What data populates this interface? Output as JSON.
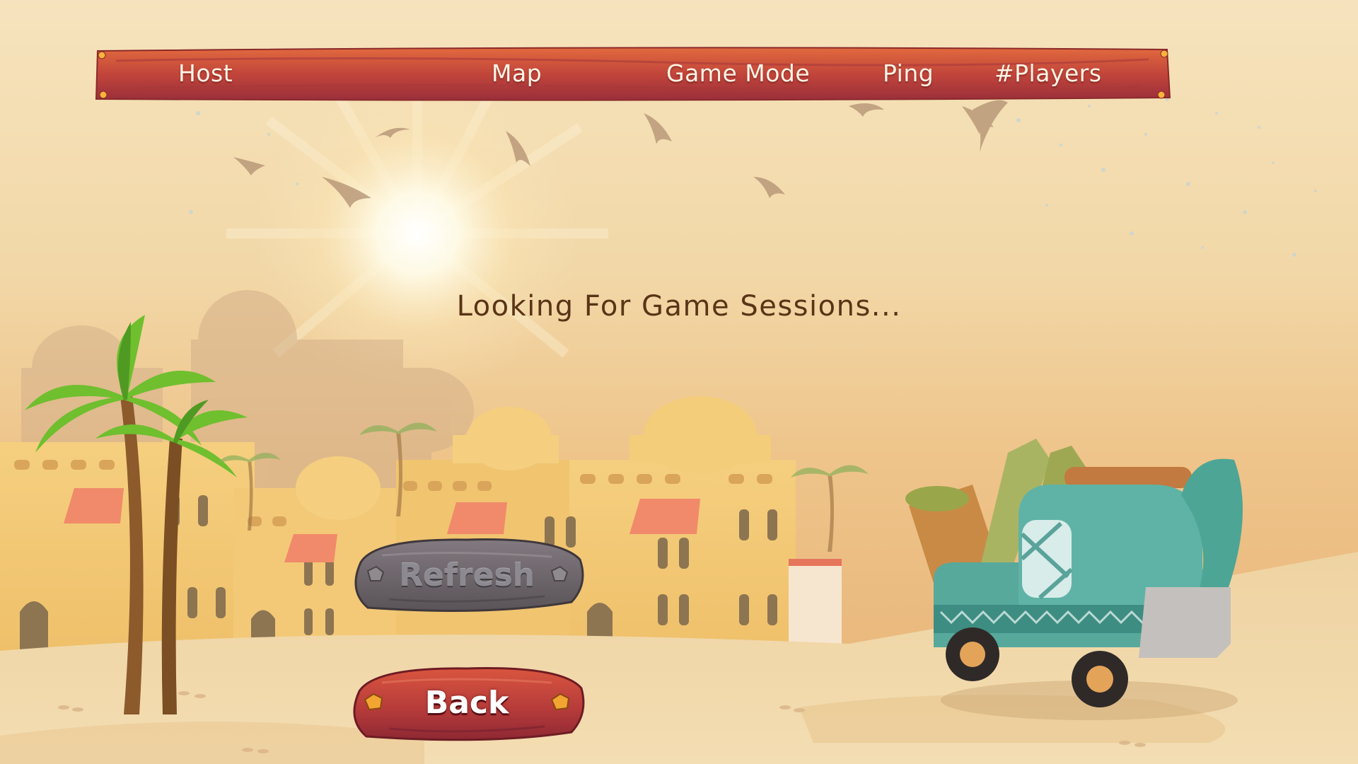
{
  "header": {
    "columns": [
      {
        "label": "Host"
      },
      {
        "label": "Map"
      },
      {
        "label": "Game Mode"
      },
      {
        "label": "Ping"
      },
      {
        "label": "#Players"
      }
    ]
  },
  "status": {
    "text": "Looking For Game Sessions..."
  },
  "buttons": {
    "refresh": {
      "label": "Refresh",
      "state": "disabled"
    },
    "back": {
      "label": "Back"
    }
  },
  "colors": {
    "header_wood": "#b9403c",
    "back_wood": "#b43a3a",
    "refresh_wood": "#6e666c",
    "status_text": "#5a3416",
    "sky": "#f2d8a8"
  }
}
